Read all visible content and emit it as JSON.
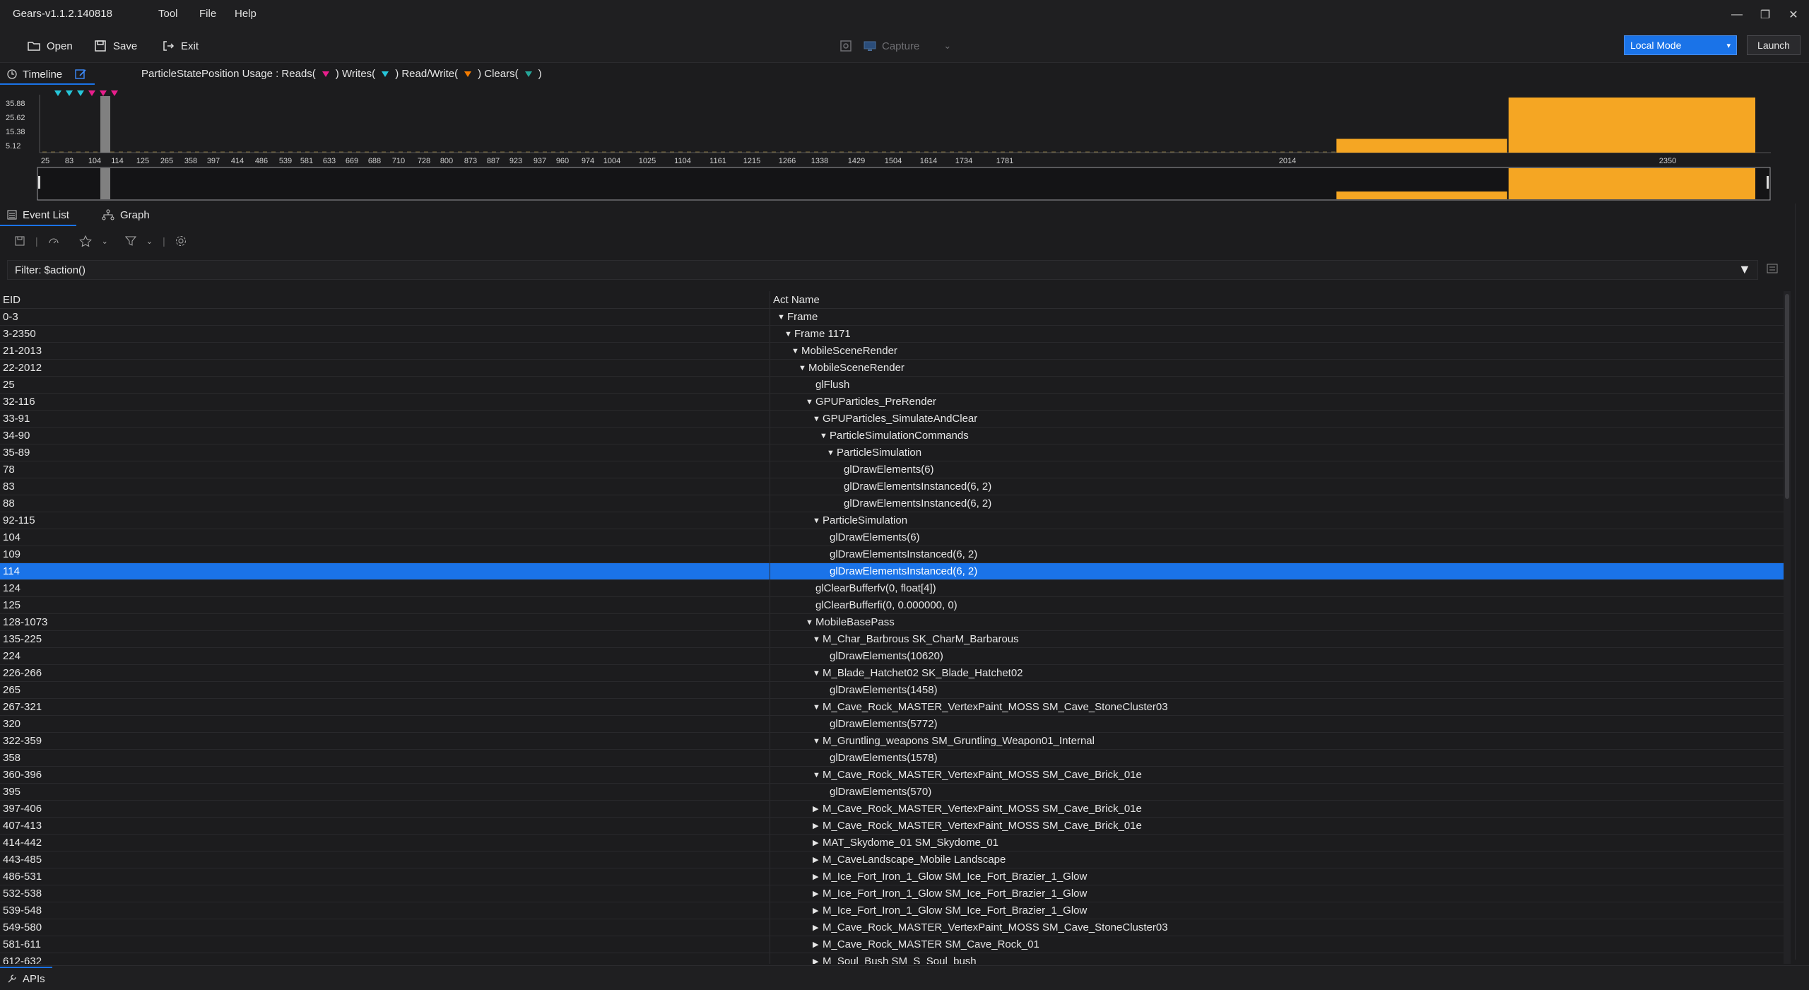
{
  "app": {
    "title": "Gears-v1.1.2.140818"
  },
  "menu": {
    "items": [
      "Tool",
      "File",
      "Help"
    ]
  },
  "window_controls": {
    "minimize": "—",
    "restore": "❐",
    "close": "✕"
  },
  "toolbar": {
    "open_label": "Open",
    "save_label": "Save",
    "exit_label": "Exit",
    "capture_label": "Capture",
    "mode_value": "Local Mode",
    "launch_label": "Launch"
  },
  "timeline": {
    "tab_label": "Timeline",
    "legend_text": "ParticleStatePosition  Usage :  Reads(",
    "legend_writes": ")  Writes(",
    "legend_rw": ")  Read/Write(",
    "legend_clears": ")  Clears(",
    "legend_end": ")",
    "colors": {
      "reads": "#e91e8c",
      "writes": "#26c6da",
      "readwrite": "#f57c00",
      "clears": "#26a69a",
      "bar": "#f5a623",
      "marker": "#808080"
    },
    "y_ticks": [
      "35.88",
      "25.62",
      "15.38",
      "5.12"
    ],
    "x_ticks": [
      "25",
      "83",
      "104",
      "114",
      "125",
      "265",
      "358",
      "397",
      "414",
      "486",
      "539",
      "581",
      "633",
      "669",
      "688",
      "710",
      "728",
      "800",
      "873",
      "887",
      "923",
      "937",
      "960",
      "974",
      "1004",
      "1025",
      "1104",
      "1161",
      "1215",
      "1266",
      "1338",
      "1429",
      "1504",
      "1614",
      "1734",
      "1781",
      "2014",
      "2350"
    ]
  },
  "chart_data": {
    "type": "bar",
    "x_range": [
      25,
      2350
    ],
    "ylim": [
      0,
      40
    ],
    "y_ticks": [
      5.12,
      15.38,
      25.62,
      35.88
    ],
    "series": [
      {
        "values": [
          {
            "x0": 1781,
            "x1": 2014,
            "y": 10
          },
          {
            "x0": 2014,
            "x1": 2350,
            "y": 40
          }
        ]
      }
    ],
    "markers": [
      {
        "x": 114,
        "type": "selected"
      }
    ],
    "usage_markers": [
      "writes",
      "writes",
      "writes",
      "reads",
      "reads",
      "reads"
    ]
  },
  "panel_tabs": {
    "event_list": "Event List",
    "graph": "Graph"
  },
  "filter": {
    "text": "Filter: $action()"
  },
  "table": {
    "headers": {
      "eid": "EID",
      "name": "Act Name"
    },
    "rows": [
      {
        "eid": "0-3",
        "name": "Frame",
        "depth": 0,
        "arrow": "▼"
      },
      {
        "eid": "3-2350",
        "name": "Frame 1171",
        "depth": 1,
        "arrow": "▼"
      },
      {
        "eid": "21-2013",
        "name": "MobileSceneRender",
        "depth": 2,
        "arrow": "▼"
      },
      {
        "eid": "22-2012",
        "name": "MobileSceneRender",
        "depth": 3,
        "arrow": "▼"
      },
      {
        "eid": "25",
        "name": "glFlush",
        "depth": 4,
        "arrow": ""
      },
      {
        "eid": "32-116",
        "name": "GPUParticles_PreRender",
        "depth": 4,
        "arrow": "▼"
      },
      {
        "eid": "33-91",
        "name": "GPUParticles_SimulateAndClear",
        "depth": 5,
        "arrow": "▼"
      },
      {
        "eid": "34-90",
        "name": "ParticleSimulationCommands",
        "depth": 6,
        "arrow": "▼"
      },
      {
        "eid": "35-89",
        "name": "ParticleSimulation",
        "depth": 7,
        "arrow": "▼"
      },
      {
        "eid": "78",
        "name": "glDrawElements(6)",
        "depth": 8,
        "arrow": ""
      },
      {
        "eid": "83",
        "name": "glDrawElementsInstanced(6, 2)",
        "depth": 8,
        "arrow": ""
      },
      {
        "eid": "88",
        "name": "glDrawElementsInstanced(6, 2)",
        "depth": 8,
        "arrow": ""
      },
      {
        "eid": "92-115",
        "name": "ParticleSimulation",
        "depth": 5,
        "arrow": "▼"
      },
      {
        "eid": "104",
        "name": "glDrawElements(6)",
        "depth": 6,
        "arrow": ""
      },
      {
        "eid": "109",
        "name": "glDrawElementsInstanced(6, 2)",
        "depth": 6,
        "arrow": ""
      },
      {
        "eid": "114",
        "name": "glDrawElementsInstanced(6, 2)",
        "depth": 6,
        "arrow": "",
        "selected": true
      },
      {
        "eid": "124",
        "name": "glClearBufferfv(0, float[4])",
        "depth": 4,
        "arrow": ""
      },
      {
        "eid": "125",
        "name": "glClearBufferfi(0, 0.000000, 0)",
        "depth": 4,
        "arrow": ""
      },
      {
        "eid": "128-1073",
        "name": "MobileBasePass",
        "depth": 4,
        "arrow": "▼"
      },
      {
        "eid": "135-225",
        "name": "M_Char_Barbrous SK_CharM_Barbarous",
        "depth": 5,
        "arrow": "▼"
      },
      {
        "eid": "224",
        "name": "glDrawElements(10620)",
        "depth": 6,
        "arrow": ""
      },
      {
        "eid": "226-266",
        "name": "M_Blade_Hatchet02 SK_Blade_Hatchet02",
        "depth": 5,
        "arrow": "▼"
      },
      {
        "eid": "265",
        "name": "glDrawElements(1458)",
        "depth": 6,
        "arrow": ""
      },
      {
        "eid": "267-321",
        "name": "M_Cave_Rock_MASTER_VertexPaint_MOSS SM_Cave_StoneCluster03",
        "depth": 5,
        "arrow": "▼"
      },
      {
        "eid": "320",
        "name": "glDrawElements(5772)",
        "depth": 6,
        "arrow": ""
      },
      {
        "eid": "322-359",
        "name": "M_Gruntling_weapons SM_Gruntling_Weapon01_Internal",
        "depth": 5,
        "arrow": "▼"
      },
      {
        "eid": "358",
        "name": "glDrawElements(1578)",
        "depth": 6,
        "arrow": ""
      },
      {
        "eid": "360-396",
        "name": "M_Cave_Rock_MASTER_VertexPaint_MOSS SM_Cave_Brick_01e",
        "depth": 5,
        "arrow": "▼"
      },
      {
        "eid": "395",
        "name": "glDrawElements(570)",
        "depth": 6,
        "arrow": ""
      },
      {
        "eid": "397-406",
        "name": "M_Cave_Rock_MASTER_VertexPaint_MOSS SM_Cave_Brick_01e",
        "depth": 5,
        "arrow": "▶"
      },
      {
        "eid": "407-413",
        "name": "M_Cave_Rock_MASTER_VertexPaint_MOSS SM_Cave_Brick_01e",
        "depth": 5,
        "arrow": "▶"
      },
      {
        "eid": "414-442",
        "name": "MAT_Skydome_01 SM_Skydome_01",
        "depth": 5,
        "arrow": "▶"
      },
      {
        "eid": "443-485",
        "name": "M_CaveLandscape_Mobile Landscape",
        "depth": 5,
        "arrow": "▶"
      },
      {
        "eid": "486-531",
        "name": "M_Ice_Fort_Iron_1_Glow SM_Ice_Fort_Brazier_1_Glow",
        "depth": 5,
        "arrow": "▶"
      },
      {
        "eid": "532-538",
        "name": "M_Ice_Fort_Iron_1_Glow SM_Ice_Fort_Brazier_1_Glow",
        "depth": 5,
        "arrow": "▶"
      },
      {
        "eid": "539-548",
        "name": "M_Ice_Fort_Iron_1_Glow SM_Ice_Fort_Brazier_1_Glow",
        "depth": 5,
        "arrow": "▶"
      },
      {
        "eid": "549-580",
        "name": "M_Cave_Rock_MASTER_VertexPaint_MOSS SM_Cave_StoneCluster03",
        "depth": 5,
        "arrow": "▶"
      },
      {
        "eid": "581-611",
        "name": "M_Cave_Rock_MASTER SM_Cave_Rock_01",
        "depth": 5,
        "arrow": "▶"
      },
      {
        "eid": "612-632",
        "name": "M_Soul_Bush SM_S_Soul_bush",
        "depth": 5,
        "arrow": "▶"
      }
    ]
  },
  "bottom": {
    "apis_label": "APIs"
  }
}
